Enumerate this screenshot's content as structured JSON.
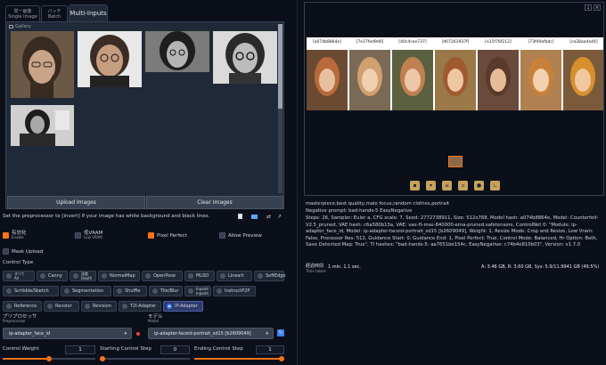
{
  "tabs": [
    {
      "line1": "単一画像",
      "line2": "Single Image"
    },
    {
      "line1": "バッチ",
      "line2": "Batch"
    },
    {
      "label": "Multi-Inputs"
    }
  ],
  "gallery": {
    "label": "Gallery"
  },
  "upload_button": "Upload Images",
  "clear_button": "Clear Images",
  "hint_text": "Set the preprocessor to [invert] If your image has white background and black lines.",
  "options": {
    "enable": {
      "label": "有効化",
      "sub": "Enable",
      "checked": true
    },
    "low_vram": {
      "label": "低VRAM",
      "sub": "Low VRAM",
      "checked": false
    },
    "pixel_perfect": {
      "label": "Pixel Perfect",
      "checked": true
    },
    "allow_preview": {
      "label": "Allow Preview",
      "checked": false
    },
    "mask_upload": {
      "label": "Mask Upload",
      "checked": false
    }
  },
  "control_type": {
    "label": "Control Type",
    "items": [
      {
        "label": "すべて",
        "sub": "All"
      },
      {
        "label": "Canny"
      },
      {
        "label": "深度",
        "sub": "Depth"
      },
      {
        "label": "NormalMap"
      },
      {
        "label": "OpenPose"
      },
      {
        "label": "MLSD"
      },
      {
        "label": "Lineart"
      },
      {
        "label": "SoftEdge"
      },
      {
        "label": "Scribble/Sketch"
      },
      {
        "label": "Segmentation"
      },
      {
        "label": "Shuffle"
      },
      {
        "label": "Tile/Blur"
      },
      {
        "label": "Inpaint",
        "sub": "Inpaint"
      },
      {
        "label": "InstructP2P"
      },
      {
        "label": "Reference"
      },
      {
        "label": "Recolor"
      },
      {
        "label": "Revision"
      },
      {
        "label": "T2I-Adapter"
      },
      {
        "label": "IP-Adapter",
        "selected": true
      }
    ]
  },
  "preprocessor": {
    "label": "プリプロセッサ",
    "sub": "Preprocessor",
    "value": "ip-adapter_face_id"
  },
  "model": {
    "label": "モデル",
    "sub": "Model",
    "value": "ip-adapter-faceid-portrait_sd15 [b2609049]"
  },
  "sliders": [
    {
      "label": "Control Weight",
      "value": "1",
      "fraction": 0.5
    },
    {
      "label": "Starting Control Step",
      "value": "0",
      "fraction": 0.0
    },
    {
      "label": "Ending Control Step",
      "value": "1",
      "fraction": 1.0
    }
  ],
  "output": {
    "grid_labels": [
      "[a074b8864e]",
      "[7e17fed9d0]",
      "[40c4cee737]",
      "[d07261937f]",
      "[e15f76f212]",
      "[73f49afbdc]",
      "[ca28aa4a44]"
    ],
    "prompt": "masterpiece,best quality,male focus,random clothes,portrait",
    "negative": "Negative prompt: bad-hands-5 EasyNegative",
    "params": "Steps: 26, Sampler: Euler a, CFG scale: 7, Seed: 2772738911, Size: 512x768, Model hash: a074b8864e, Model: Counterfeit-V2.5_pruned, VAE hash: c6a580b13a, VAE: vae-ft-mse-840000-ema-pruned.safetensors, ControlNet 0: \"Module: ip-adapter_face_id, Model: ip-adapter-faceid-portrait_sd15 [b2609049], Weight: 1, Resize Mode: Crop and Resize, Low Vram: False, Processor Res: 512, Guidance Start: 0, Guidance End: 1, Pixel Perfect: True, Control Mode: Balanced, Hr Option: Both, Save Detected Map: True\", TI hashes: \"bad-hands-5: aa7651be154c, EasyNegative: c74b4e810b03\", Version: v1.7.0",
    "time_label": "経過時間",
    "time_sub": "Time taken:",
    "time_value": "1 min. 1.1 sec.",
    "vram": "A: 3.46 GB, R: 3.60 GB, Sys: 5.9/11.9941 GB (49.5%)"
  },
  "icons": [
    "folder-icon",
    "save-icon",
    "zip-icon",
    "image-icon",
    "palette-icon",
    "ruler-icon"
  ],
  "colors": {
    "accent": "#f97316",
    "bg": "#0b0f19",
    "panel": "#1f2937",
    "selected": "#3b82f6"
  }
}
